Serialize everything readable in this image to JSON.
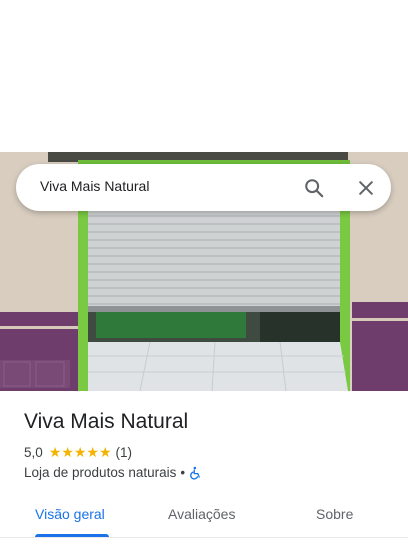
{
  "search": {
    "query": "Viva Mais Natural"
  },
  "place": {
    "title": "Viva Mais Natural",
    "rating": "5,0",
    "stars": "★★★★★",
    "review_count": "(1)",
    "category": "Loja de produtos naturais",
    "separator": "•"
  },
  "tabs": [
    {
      "label": "Visão geral",
      "selected": true
    },
    {
      "label": "Avaliações",
      "selected": false
    },
    {
      "label": "Sobre",
      "selected": false
    }
  ],
  "colors": {
    "accent": "#1a73e8",
    "stars": "#f2b400",
    "storefront_green": "#7ac943",
    "wall_purple": "#6b3a6b"
  },
  "icons": [
    "search-icon",
    "close-icon",
    "wheelchair-icon"
  ]
}
